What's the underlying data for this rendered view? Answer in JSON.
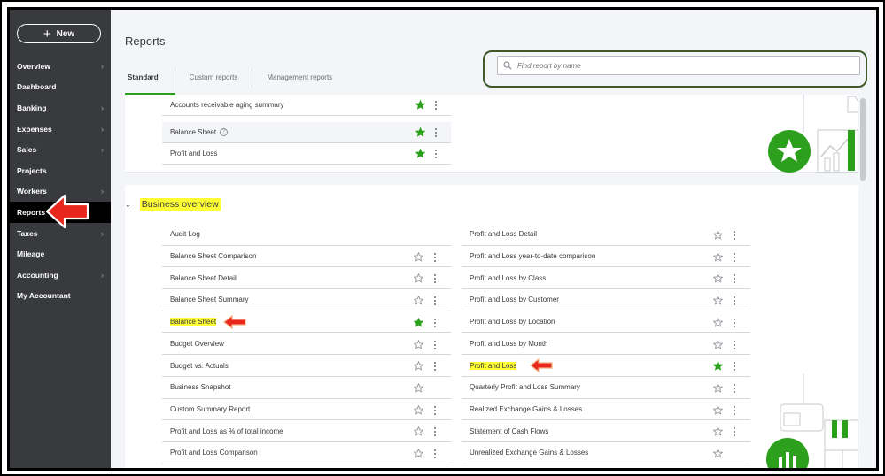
{
  "sidebar": {
    "new_label": "New",
    "items": [
      {
        "label": "Overview",
        "chevron": true
      },
      {
        "label": "Dashboard",
        "chevron": false
      },
      {
        "label": "Banking",
        "chevron": true
      },
      {
        "label": "Expenses",
        "chevron": true
      },
      {
        "label": "Sales",
        "chevron": true
      },
      {
        "label": "Projects",
        "chevron": false
      },
      {
        "label": "Workers",
        "chevron": true
      },
      {
        "label": "Reports",
        "chevron": false,
        "active": true
      },
      {
        "label": "Taxes",
        "chevron": true
      },
      {
        "label": "Mileage",
        "chevron": false
      },
      {
        "label": "Accounting",
        "chevron": true
      },
      {
        "label": "My Accountant",
        "chevron": false
      }
    ]
  },
  "header": {
    "title": "Reports",
    "tabs": [
      {
        "label": "Standard",
        "active": true
      },
      {
        "label": "Custom reports",
        "active": false
      },
      {
        "label": "Management reports",
        "active": false
      }
    ],
    "search_placeholder": "Find report by name"
  },
  "favorites": [
    {
      "name": "Accounts receivable aging summary",
      "favorited": true
    },
    {
      "name": "Balance Sheet",
      "favorited": true,
      "help": true
    },
    {
      "name": "Profit and Loss",
      "favorited": true
    }
  ],
  "business_overview": {
    "title": "Business overview",
    "left_column": [
      {
        "name": "Audit Log",
        "favorited": null,
        "highlight": false
      },
      {
        "name": "Balance Sheet Comparison",
        "favorited": false,
        "highlight": false
      },
      {
        "name": "Balance Sheet Detail",
        "favorited": false,
        "highlight": false
      },
      {
        "name": "Balance Sheet Summary",
        "favorited": false,
        "highlight": false
      },
      {
        "name": "Balance Sheet",
        "favorited": true,
        "highlight": true
      },
      {
        "name": "Budget Overview",
        "favorited": false,
        "highlight": false
      },
      {
        "name": "Budget vs. Actuals",
        "favorited": false,
        "highlight": false
      },
      {
        "name": "Business Snapshot",
        "favorited": false,
        "highlight": false,
        "no_menu": true
      },
      {
        "name": "Custom Summary Report",
        "favorited": false,
        "highlight": false
      },
      {
        "name": "Profit and Loss as % of total income",
        "favorited": false,
        "highlight": false
      },
      {
        "name": "Profit and Loss Comparison",
        "favorited": false,
        "highlight": false
      }
    ],
    "right_column": [
      {
        "name": "Profit and Loss Detail",
        "favorited": false,
        "highlight": false
      },
      {
        "name": "Profit and Loss year-to-date comparison",
        "favorited": false,
        "highlight": false
      },
      {
        "name": "Profit and Loss by Class",
        "favorited": false,
        "highlight": false
      },
      {
        "name": "Profit and Loss by Customer",
        "favorited": false,
        "highlight": false
      },
      {
        "name": "Profit and Loss by Location",
        "favorited": false,
        "highlight": false
      },
      {
        "name": "Profit and Loss by Month",
        "favorited": false,
        "highlight": false
      },
      {
        "name": "Profit and Loss",
        "favorited": true,
        "highlight": true
      },
      {
        "name": "Quarterly Profit and Loss Summary",
        "favorited": false,
        "highlight": false
      },
      {
        "name": "Realized Exchange Gains & Losses",
        "favorited": false,
        "highlight": false
      },
      {
        "name": "Statement of Cash Flows",
        "favorited": false,
        "highlight": false
      },
      {
        "name": "Unrealized Exchange Gains & Losses",
        "favorited": false,
        "highlight": false,
        "no_menu": true
      }
    ]
  },
  "colors": {
    "sidebar_bg": "#393a3d",
    "accent_green": "#2ca01c",
    "highlight_yellow": "#ffff33",
    "arrow_red": "#e8261c"
  }
}
